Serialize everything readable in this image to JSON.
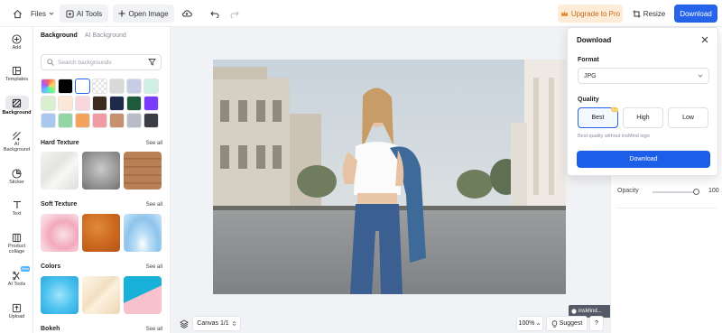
{
  "topbar": {
    "files_label": "Files",
    "ai_tools_label": "AI Tools",
    "open_image_label": "Open Image",
    "upgrade_label": "Upgrade to Pro",
    "resize_label": "Resize",
    "download_label": "Download"
  },
  "rail": {
    "items": [
      {
        "label": "Add",
        "icon": "plus-circle-icon"
      },
      {
        "label": "Templates",
        "icon": "templates-icon"
      },
      {
        "label": "Background",
        "icon": "background-icon"
      },
      {
        "label": "AI Background",
        "icon": "ai-background-icon"
      },
      {
        "label": "Sticker",
        "icon": "sticker-icon"
      },
      {
        "label": "Text",
        "icon": "text-icon"
      },
      {
        "label": "Product collage",
        "icon": "collage-icon"
      },
      {
        "label": "AI Tools",
        "icon": "ai-tools-icon",
        "badge": "New"
      },
      {
        "label": "Upload",
        "icon": "upload-icon"
      }
    ]
  },
  "panel": {
    "tab_background": "Background",
    "tab_ai_background": "AI Background",
    "search_placeholder": "Search backgrounds",
    "swatches": [
      "gradient",
      "#000000",
      "#ffffff",
      "transparent",
      "#d9d9d9",
      "#c8cde6",
      "#cfefe3",
      "#d9efcf",
      "#fde8d8",
      "#f9d6dc",
      "#3a2a1f",
      "#1e2a4a",
      "#1f5a3b",
      "#7a3cff",
      "#a8c8f0",
      "#92d6a4",
      "#f3a35b",
      "#f09aa3",
      "#c7906e",
      "#b7bcc6",
      "#3b3d42"
    ],
    "sections": [
      {
        "title": "Hard Texture",
        "see_all": "See all"
      },
      {
        "title": "Soft Texture",
        "see_all": "See all"
      },
      {
        "title": "Colors",
        "see_all": "See all"
      },
      {
        "title": "Bokeh",
        "see_all": "See all"
      }
    ]
  },
  "canvas": {
    "watermark": "insMind...",
    "page_label": "Canvas 1/1",
    "zoom": "100%",
    "suggest": "Suggest",
    "help": "?"
  },
  "right": {
    "opacity_label": "Opacity",
    "opacity_value": "100",
    "opacity_fraction": 1
  },
  "download_popup": {
    "title": "Download",
    "format_label": "Format",
    "format_value": "JPG",
    "quality_label": "Quality",
    "quality_options": [
      "Best",
      "High",
      "Low"
    ],
    "pro_badge": "Pro",
    "note": "Best quality without insMind logo",
    "button_label": "Download"
  },
  "colors": {
    "accent": "#2563eb",
    "upgrade_bg": "#fdecd8",
    "upgrade_text": "#c26a14"
  }
}
